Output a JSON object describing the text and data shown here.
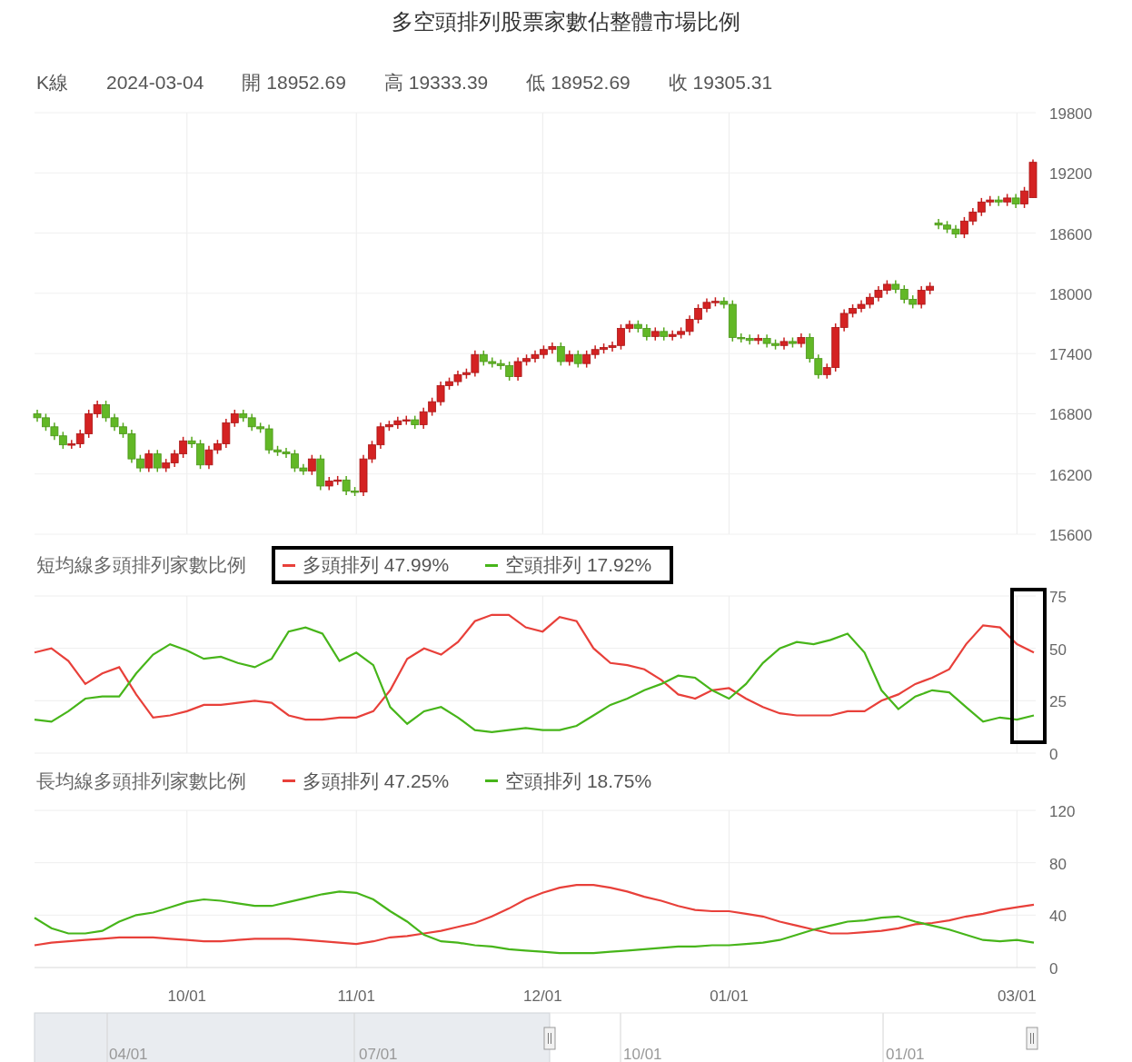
{
  "title": "多空頭排列股票家數佔整體市場比例",
  "quote": {
    "label": "K線",
    "date": "2024-03-04",
    "fields": [
      {
        "label": "開",
        "value": "18952.69"
      },
      {
        "label": "高",
        "value": "19333.39"
      },
      {
        "label": "低",
        "value": "18952.69"
      },
      {
        "label": "收",
        "value": "19305.31"
      }
    ]
  },
  "candlestick": {
    "chart_data": {
      "type": "candlestick",
      "grid": true,
      "ylim": [
        15600,
        19800
      ],
      "yticks": [
        19800,
        19200,
        18600,
        18000,
        17400,
        16800,
        16200,
        15600
      ],
      "ohlc": [
        [
          16800,
          16840,
          16720,
          16760
        ],
        [
          16760,
          16800,
          16630,
          16670
        ],
        [
          16670,
          16710,
          16540,
          16580
        ],
        [
          16580,
          16620,
          16450,
          16490
        ],
        [
          16490,
          16540,
          16450,
          16500
        ],
        [
          16500,
          16640,
          16460,
          16600
        ],
        [
          16600,
          16840,
          16560,
          16800
        ],
        [
          16800,
          16930,
          16760,
          16890
        ],
        [
          16890,
          16930,
          16720,
          16760
        ],
        [
          16760,
          16800,
          16630,
          16670
        ],
        [
          16670,
          16710,
          16560,
          16600
        ],
        [
          16600,
          16640,
          16310,
          16350
        ],
        [
          16350,
          16390,
          16220,
          16260
        ],
        [
          16260,
          16440,
          16220,
          16400
        ],
        [
          16400,
          16440,
          16220,
          16260
        ],
        [
          16260,
          16350,
          16220,
          16310
        ],
        [
          16310,
          16440,
          16270,
          16400
        ],
        [
          16400,
          16570,
          16360,
          16530
        ],
        [
          16530,
          16570,
          16460,
          16500
        ],
        [
          16500,
          16540,
          16250,
          16290
        ],
        [
          16290,
          16480,
          16250,
          16440
        ],
        [
          16440,
          16540,
          16400,
          16500
        ],
        [
          16500,
          16750,
          16460,
          16710
        ],
        [
          16710,
          16840,
          16670,
          16800
        ],
        [
          16800,
          16840,
          16720,
          16760
        ],
        [
          16760,
          16800,
          16630,
          16670
        ],
        [
          16670,
          16710,
          16610,
          16650
        ],
        [
          16650,
          16690,
          16400,
          16440
        ],
        [
          16440,
          16480,
          16380,
          16420
        ],
        [
          16420,
          16460,
          16360,
          16400
        ],
        [
          16400,
          16440,
          16220,
          16260
        ],
        [
          16260,
          16300,
          16190,
          16230
        ],
        [
          16230,
          16390,
          16190,
          16350
        ],
        [
          16350,
          16390,
          16040,
          16080
        ],
        [
          16080,
          16170,
          16040,
          16130
        ],
        [
          16130,
          16180,
          16090,
          16140
        ],
        [
          16140,
          16180,
          15990,
          16030
        ],
        [
          16030,
          16070,
          15980,
          16020
        ],
        [
          16020,
          16390,
          15980,
          16350
        ],
        [
          16350,
          16530,
          16310,
          16490
        ],
        [
          16490,
          16710,
          16450,
          16670
        ],
        [
          16670,
          16730,
          16630,
          16690
        ],
        [
          16690,
          16770,
          16650,
          16730
        ],
        [
          16730,
          16780,
          16690,
          16740
        ],
        [
          16740,
          16780,
          16650,
          16690
        ],
        [
          16690,
          16860,
          16650,
          16820
        ],
        [
          16820,
          16960,
          16780,
          16920
        ],
        [
          16920,
          17120,
          16880,
          17080
        ],
        [
          17080,
          17160,
          17040,
          17120
        ],
        [
          17120,
          17230,
          17080,
          17190
        ],
        [
          17190,
          17250,
          17150,
          17210
        ],
        [
          17210,
          17430,
          17170,
          17390
        ],
        [
          17390,
          17430,
          17280,
          17320
        ],
        [
          17320,
          17360,
          17260,
          17300
        ],
        [
          17300,
          17340,
          17240,
          17280
        ],
        [
          17280,
          17320,
          17130,
          17170
        ],
        [
          17170,
          17360,
          17130,
          17320
        ],
        [
          17320,
          17390,
          17280,
          17350
        ],
        [
          17350,
          17430,
          17310,
          17390
        ],
        [
          17390,
          17480,
          17350,
          17440
        ],
        [
          17440,
          17510,
          17400,
          17470
        ],
        [
          17470,
          17510,
          17280,
          17320
        ],
        [
          17320,
          17430,
          17280,
          17390
        ],
        [
          17390,
          17430,
          17260,
          17300
        ],
        [
          17300,
          17430,
          17260,
          17390
        ],
        [
          17390,
          17480,
          17350,
          17440
        ],
        [
          17440,
          17500,
          17400,
          17460
        ],
        [
          17460,
          17520,
          17420,
          17480
        ],
        [
          17480,
          17690,
          17440,
          17650
        ],
        [
          17650,
          17730,
          17610,
          17690
        ],
        [
          17690,
          17730,
          17610,
          17650
        ],
        [
          17650,
          17690,
          17530,
          17570
        ],
        [
          17570,
          17660,
          17530,
          17620
        ],
        [
          17620,
          17660,
          17530,
          17570
        ],
        [
          17570,
          17630,
          17530,
          17590
        ],
        [
          17590,
          17660,
          17550,
          17620
        ],
        [
          17620,
          17780,
          17580,
          17740
        ],
        [
          17740,
          17890,
          17700,
          17850
        ],
        [
          17850,
          17950,
          17810,
          17910
        ],
        [
          17910,
          17960,
          17870,
          17920
        ],
        [
          17920,
          17960,
          17850,
          17890
        ],
        [
          17890,
          17930,
          17520,
          17560
        ],
        [
          17560,
          17600,
          17510,
          17550
        ],
        [
          17550,
          17590,
          17490,
          17530
        ],
        [
          17530,
          17590,
          17490,
          17550
        ],
        [
          17550,
          17590,
          17460,
          17500
        ],
        [
          17500,
          17540,
          17440,
          17480
        ],
        [
          17480,
          17560,
          17440,
          17520
        ],
        [
          17520,
          17560,
          17460,
          17500
        ],
        [
          17500,
          17600,
          17460,
          17560
        ],
        [
          17560,
          17600,
          17310,
          17350
        ],
        [
          17350,
          17390,
          17150,
          17190
        ],
        [
          17190,
          17300,
          17150,
          17260
        ],
        [
          17260,
          17700,
          17220,
          17660
        ],
        [
          17660,
          17840,
          17620,
          17800
        ],
        [
          17800,
          17890,
          17760,
          17850
        ],
        [
          17850,
          17930,
          17810,
          17890
        ],
        [
          17890,
          18000,
          17850,
          17960
        ],
        [
          17960,
          18070,
          17920,
          18030
        ],
        [
          18030,
          18130,
          17990,
          18090
        ],
        [
          18090,
          18130,
          18000,
          18040
        ],
        [
          18040,
          18080,
          17900,
          17940
        ],
        [
          17940,
          17980,
          17850,
          17890
        ],
        [
          17890,
          18070,
          17850,
          18030
        ],
        [
          18030,
          18110,
          17990,
          18070
        ],
        [
          18700,
          18740,
          18640,
          18680
        ],
        [
          18680,
          18720,
          18600,
          18640
        ],
        [
          18640,
          18680,
          18550,
          18590
        ],
        [
          18590,
          18760,
          18550,
          18720
        ],
        [
          18720,
          18850,
          18680,
          18810
        ],
        [
          18810,
          18950,
          18770,
          18910
        ],
        [
          18910,
          18970,
          18870,
          18930
        ],
        [
          18930,
          18970,
          18870,
          18910
        ],
        [
          18910,
          18990,
          18870,
          18950
        ],
        [
          18950,
          18990,
          18850,
          18890
        ],
        [
          18890,
          19060,
          18850,
          19020
        ],
        [
          18952.69,
          19333.39,
          18952.69,
          19305.31
        ]
      ]
    }
  },
  "short": {
    "title": "短均線多頭排列家數比例",
    "legend_values": [
      "47.99%",
      "17.92%"
    ],
    "legend_highlighted": true,
    "end_highlighted": true,
    "chart_data": {
      "type": "line",
      "grid": true,
      "ylim": [
        0,
        75
      ],
      "yticks": [
        0,
        25,
        50,
        75
      ],
      "series": [
        {
          "name": "多頭排列",
          "color": "#e8403a",
          "values": [
            48,
            50,
            44,
            33,
            38,
            41,
            28,
            17,
            18,
            20,
            23,
            23,
            24,
            25,
            24,
            18,
            16,
            16,
            17,
            17,
            20,
            30,
            45,
            50,
            47,
            53,
            63,
            66,
            66,
            60,
            58,
            65,
            63,
            50,
            43,
            42,
            40,
            35,
            28,
            26,
            30,
            31,
            26,
            22,
            19,
            18,
            18,
            18,
            20,
            20,
            25,
            28,
            33,
            36,
            40,
            52,
            61,
            60,
            52,
            48
          ]
        },
        {
          "name": "空頭排列",
          "color": "#47b51a",
          "values": [
            16,
            15,
            20,
            26,
            27,
            27,
            38,
            47,
            52,
            49,
            45,
            46,
            43,
            41,
            45,
            58,
            60,
            57,
            44,
            48,
            42,
            22,
            14,
            20,
            22,
            17,
            11,
            10,
            11,
            12,
            11,
            11,
            13,
            18,
            23,
            26,
            30,
            33,
            37,
            36,
            30,
            26,
            33,
            43,
            50,
            53,
            52,
            54,
            57,
            48,
            30,
            21,
            27,
            30,
            29,
            22,
            15,
            17,
            16,
            18
          ]
        }
      ]
    }
  },
  "long": {
    "title": "長均線多頭排列家數比例",
    "legend_values": [
      "47.25%",
      "18.75%"
    ],
    "legend_highlighted": false,
    "chart_data": {
      "type": "line",
      "grid": true,
      "ylim": [
        0,
        120
      ],
      "yticks": [
        0,
        40,
        80,
        120
      ],
      "categories": [
        null,
        null,
        null,
        null,
        null,
        null,
        null,
        null,
        null,
        "10/01",
        null,
        null,
        null,
        null,
        null,
        null,
        null,
        null,
        null,
        "11/01",
        null,
        null,
        null,
        null,
        null,
        null,
        null,
        null,
        null,
        null,
        "12/01",
        null,
        null,
        null,
        null,
        null,
        null,
        null,
        null,
        null,
        null,
        "01/01",
        null,
        null,
        null,
        null,
        null,
        null,
        null,
        null,
        null,
        null,
        null,
        null,
        null,
        null,
        null,
        null,
        "03/01",
        null
      ],
      "series": [
        {
          "name": "多頭排列",
          "color": "#e8403a",
          "values": [
            17,
            19,
            20,
            21,
            22,
            23,
            23,
            23,
            22,
            21,
            20,
            20,
            21,
            22,
            22,
            22,
            21,
            20,
            19,
            18,
            20,
            23,
            24,
            26,
            28,
            31,
            34,
            39,
            45,
            52,
            57,
            61,
            63,
            63,
            61,
            58,
            54,
            51,
            47,
            44,
            43,
            43,
            41,
            39,
            35,
            32,
            29,
            26,
            26,
            27,
            28,
            30,
            33,
            34,
            36,
            39,
            41,
            44,
            46,
            48
          ]
        },
        {
          "name": "空頭排列",
          "color": "#47b51a",
          "values": [
            38,
            30,
            26,
            26,
            28,
            35,
            40,
            42,
            46,
            50,
            52,
            51,
            49,
            47,
            47,
            50,
            53,
            56,
            58,
            57,
            52,
            43,
            35,
            25,
            20,
            19,
            17,
            16,
            14,
            13,
            12,
            11,
            11,
            11,
            12,
            13,
            14,
            15,
            16,
            16,
            17,
            17,
            18,
            19,
            21,
            25,
            29,
            32,
            35,
            36,
            38,
            39,
            35,
            32,
            29,
            25,
            21,
            20,
            21,
            19
          ]
        }
      ]
    }
  },
  "navigator": {
    "labels": [
      "04/01",
      "07/01",
      "10/01",
      "01/01"
    ]
  }
}
